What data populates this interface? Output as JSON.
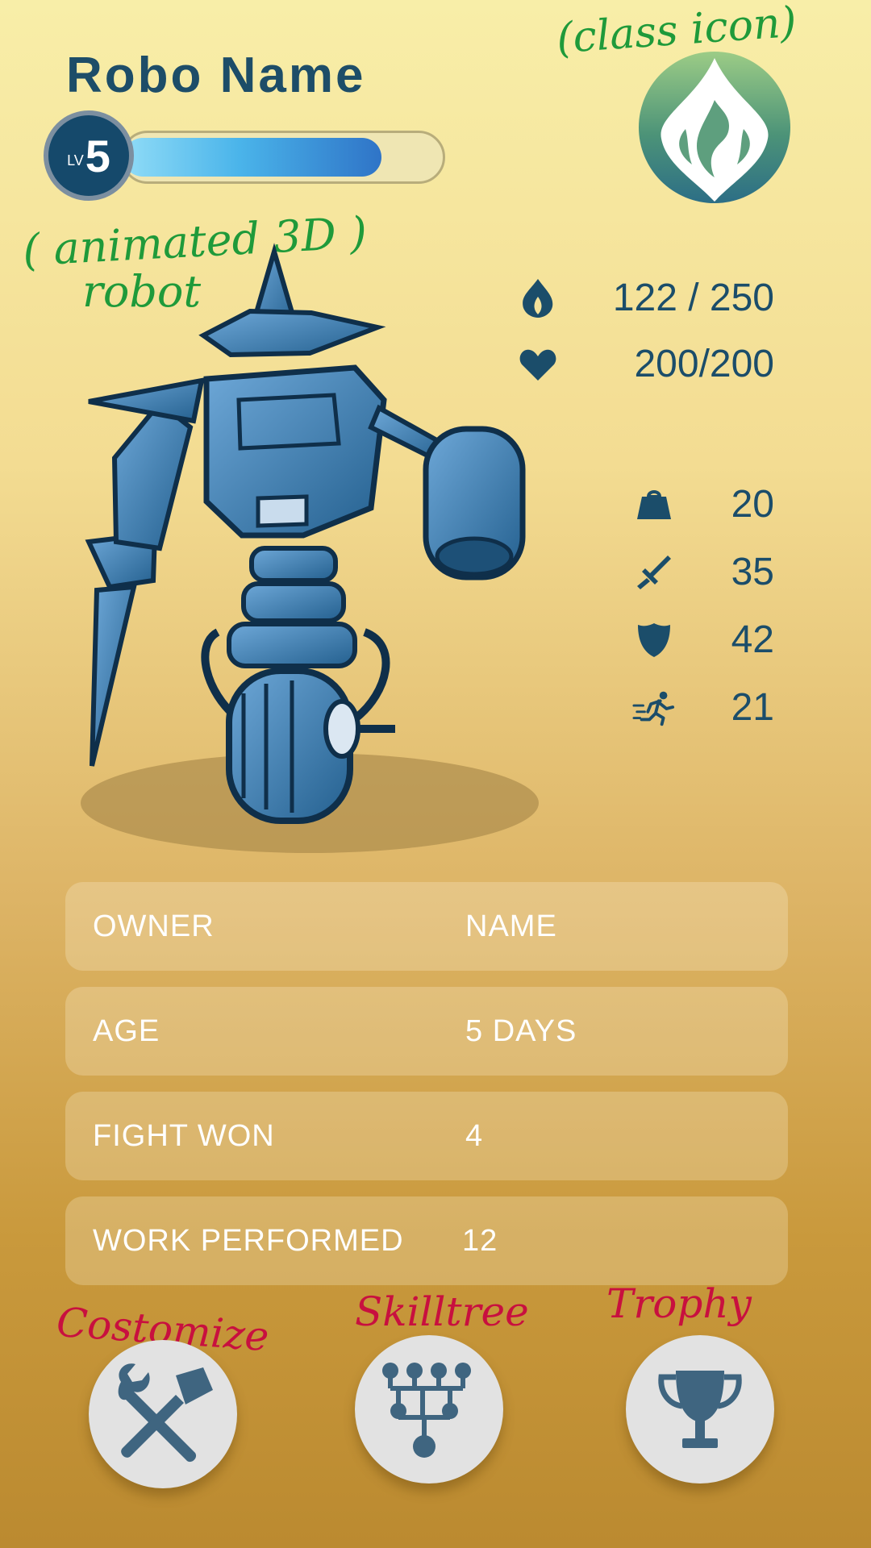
{
  "robot": {
    "name": "Robo Name",
    "level_prefix": "LV",
    "level": "5",
    "xp_fraction": 0.82
  },
  "stats": {
    "energy": {
      "icon": "flame-icon",
      "value": "122 / 250"
    },
    "health": {
      "icon": "heart-icon",
      "value": "200/200"
    },
    "capacity": {
      "icon": "weight-icon",
      "value": "20"
    },
    "attack": {
      "icon": "sword-icon",
      "value": "35"
    },
    "defense": {
      "icon": "shield-icon",
      "value": "42"
    },
    "speed": {
      "icon": "running-icon",
      "value": "21"
    }
  },
  "info": [
    {
      "label": "OWNER",
      "value": "NAME"
    },
    {
      "label": "AGE",
      "value": "5 DAYS"
    },
    {
      "label": "FIGHT WON",
      "value": "4"
    },
    {
      "label": "WORK PERFORMED",
      "value": "12"
    }
  ],
  "actions": [
    {
      "icon": "tools-icon"
    },
    {
      "icon": "skill-tree-icon"
    },
    {
      "icon": "trophy-icon"
    }
  ],
  "annotations": {
    "class_icon": "(class icon)",
    "robot_line1": "( animated 3D )",
    "robot_line2": "robot",
    "customize": "Costomize",
    "skilltree": "Skilltree",
    "trophy": "Trophy"
  },
  "colors": {
    "primary": "#1b4d6a",
    "xp_bar": "#4ab4ea",
    "note_green": "#1f9a3a",
    "note_red": "#c8103f"
  }
}
